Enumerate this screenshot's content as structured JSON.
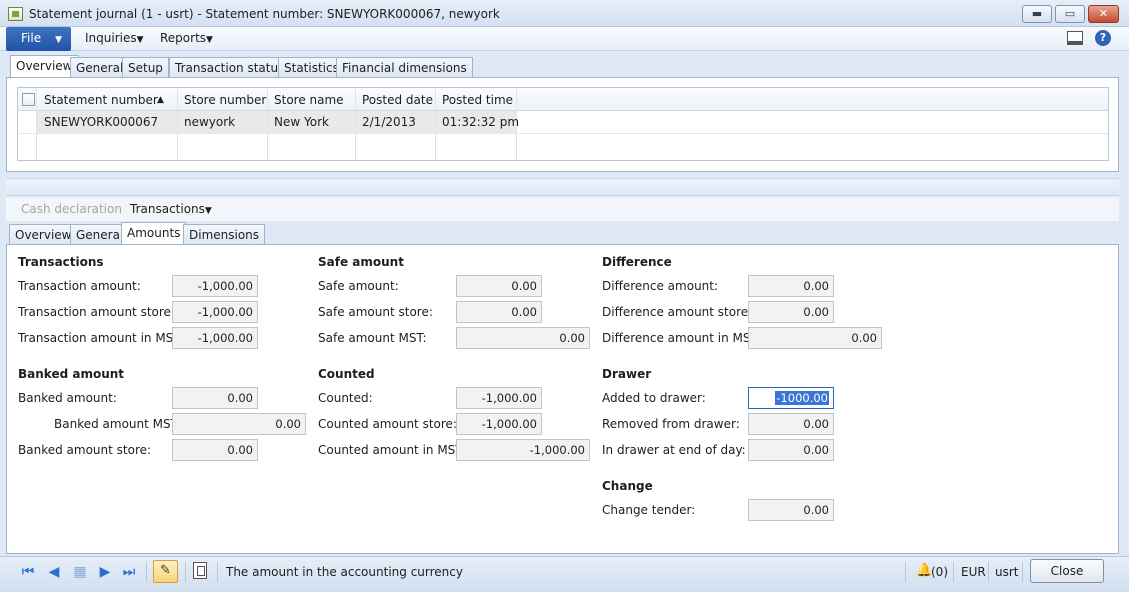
{
  "window": {
    "title": "Statement journal (1 - usrt) - Statement number: SNEWYORK000067, newyork",
    "min_label": "▬",
    "max_label": "▭",
    "close_label": "✕"
  },
  "menu": {
    "file": "File",
    "inquiries": "Inquiries",
    "reports": "Reports",
    "help": "?"
  },
  "upper_tabs": [
    "Overview",
    "General",
    "Setup",
    "Transaction status",
    "Statistics",
    "Financial dimensions"
  ],
  "grid": {
    "columns": [
      "Statement number",
      "Store number",
      "Store name",
      "Posted date",
      "Posted time"
    ],
    "sort_indicator": "▲",
    "rows": [
      [
        "SNEWYORK000067",
        "newyork",
        "New York",
        "2/1/2013",
        "01:32:32 pm"
      ]
    ]
  },
  "lower_actions": {
    "cash_declaration": "Cash declaration",
    "transactions": "Transactions"
  },
  "lower_tabs": [
    "Overview",
    "General",
    "Amounts",
    "Dimensions"
  ],
  "amounts": {
    "transactions": {
      "title": "Transactions",
      "fields": [
        {
          "label": "Transaction amount:",
          "value": "-1,000.00"
        },
        {
          "label": "Transaction amount store:",
          "value": "-1,000.00"
        },
        {
          "label": "Transaction amount in MST:",
          "value": "-1,000.00"
        }
      ]
    },
    "banked": {
      "title": "Banked amount",
      "fields": [
        {
          "label": "Banked amount:",
          "value": "0.00"
        },
        {
          "label": "Banked amount MST:",
          "value": "0.00"
        },
        {
          "label": "Banked amount store:",
          "value": "0.00"
        }
      ]
    },
    "safe": {
      "title": "Safe amount",
      "fields": [
        {
          "label": "Safe amount:",
          "value": "0.00"
        },
        {
          "label": "Safe amount store:",
          "value": "0.00"
        },
        {
          "label": "Safe amount MST:",
          "value": "0.00"
        }
      ]
    },
    "counted": {
      "title": "Counted",
      "fields": [
        {
          "label": "Counted:",
          "value": "-1,000.00"
        },
        {
          "label": "Counted amount store:",
          "value": "-1,000.00"
        },
        {
          "label": "Counted amount in MST:",
          "value": "-1,000.00"
        }
      ]
    },
    "difference": {
      "title": "Difference",
      "fields": [
        {
          "label": "Difference amount:",
          "value": "0.00"
        },
        {
          "label": "Difference amount store:",
          "value": "0.00"
        },
        {
          "label": "Difference amount in MST:",
          "value": "0.00"
        }
      ]
    },
    "drawer": {
      "title": "Drawer",
      "fields": [
        {
          "label": "Added to drawer:",
          "value": "-1000.00"
        },
        {
          "label": "Removed from drawer:",
          "value": "0.00"
        },
        {
          "label": "In drawer at end of day:",
          "value": "0.00"
        }
      ]
    },
    "change": {
      "title": "Change",
      "fields": [
        {
          "label": "Change tender:",
          "value": "0.00"
        }
      ]
    }
  },
  "statusbar": {
    "message": "The amount in the accounting currency",
    "notifications": "(0)",
    "currency": "EUR",
    "user": "usrt",
    "close_label": "Close"
  }
}
